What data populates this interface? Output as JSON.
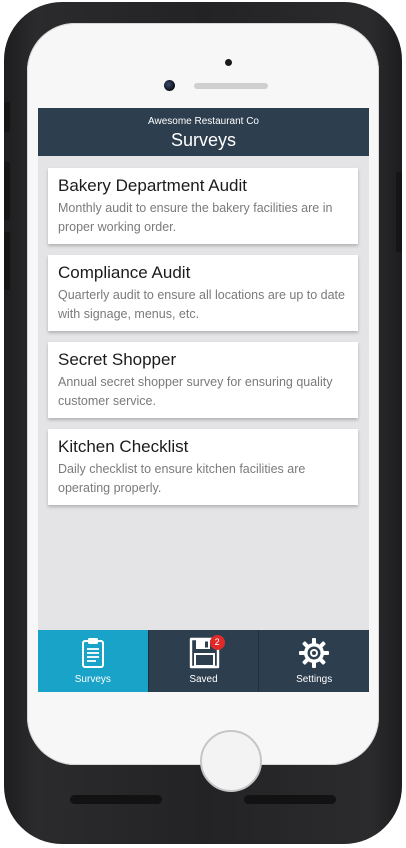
{
  "header": {
    "company": "Awesome Restaurant Co",
    "title": "Surveys"
  },
  "surveys": [
    {
      "title": "Bakery Department Audit",
      "description": "Monthly audit to ensure the bakery facilities are in proper working order."
    },
    {
      "title": "Compliance Audit",
      "description": "Quarterly audit to ensure all locations are up to date with signage, menus, etc."
    },
    {
      "title": "Secret Shopper",
      "description": "Annual secret shopper survey for ensuring quality customer service."
    },
    {
      "title": "Kitchen Checklist",
      "description": "Daily checklist to ensure kitchen facilities are operating properly."
    }
  ],
  "tabs": [
    {
      "label": "Surveys",
      "icon": "clipboard-icon",
      "active": true
    },
    {
      "label": "Saved",
      "icon": "floppy-disk-icon",
      "badge": "2",
      "active": false
    },
    {
      "label": "Settings",
      "icon": "gear-icon",
      "active": false
    }
  ],
  "colors": {
    "header_bg": "#2d3e4f",
    "active_tab": "#1aa3c8",
    "badge": "#e02a2a",
    "screen_bg": "#e4e4e6"
  }
}
